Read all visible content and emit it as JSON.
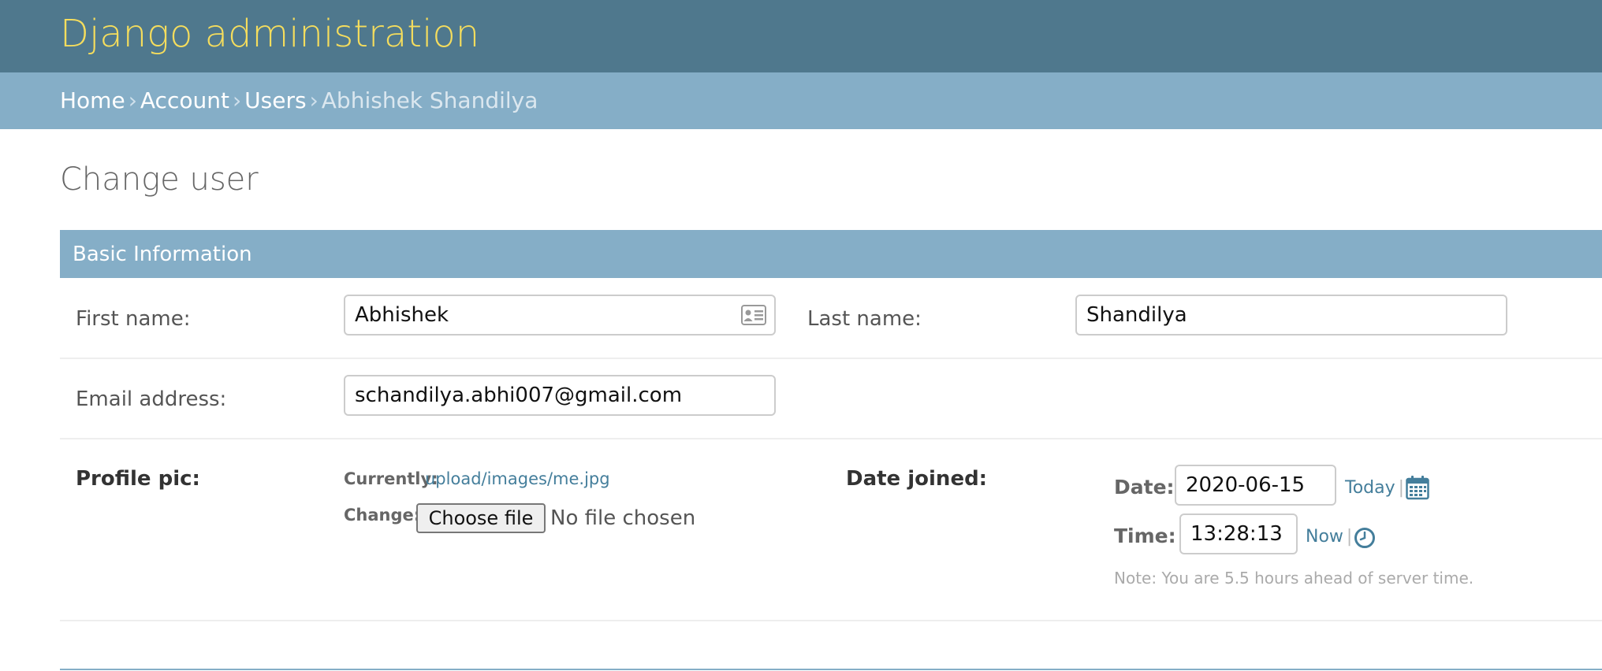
{
  "header": {
    "site_title": "Django administration"
  },
  "breadcrumbs": {
    "items": [
      "Home",
      "Account",
      "Users"
    ],
    "separator": "›",
    "current": "Abhishek Shandilya"
  },
  "page": {
    "title": "Change user"
  },
  "fieldset": {
    "title": "Basic Information"
  },
  "form": {
    "first_name": {
      "label": "First name:",
      "value": "Abhishek",
      "icon": "contact-card-icon"
    },
    "last_name": {
      "label": "Last name:",
      "value": "Shandilya"
    },
    "email": {
      "label": "Email address:",
      "value": "schandilya.abhi007@gmail.com"
    },
    "profile_pic": {
      "label": "Profile pic:",
      "currently_label": "Currently:",
      "current_file": "upload/images/me.jpg",
      "change_label": "Change:",
      "button_label": "Choose file",
      "no_file_text": "No file chosen"
    },
    "date_joined": {
      "label": "Date joined:",
      "date_label": "Date:",
      "date_value": "2020-06-15",
      "today_label": "Today",
      "time_label": "Time:",
      "time_value": "13:28:13",
      "now_label": "Now",
      "note": "Note: You are 5.5 hours ahead of server time."
    }
  },
  "colors": {
    "header_bg": "#4f788d",
    "site_title": "#f5dd5d",
    "breadcrumb_bg": "#85aec7",
    "link": "#447e9b"
  }
}
